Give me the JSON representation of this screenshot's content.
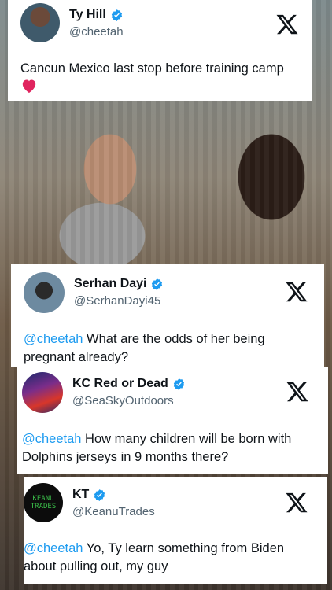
{
  "tweets": [
    {
      "name": "Ty Hill",
      "handle": "@cheetah",
      "text": "Cancun Mexico last stop before training camp",
      "emoji": "red-heart"
    },
    {
      "name": "Serhan Dayi",
      "handle": "@SerhanDayi45",
      "mention": "@cheetah",
      "text": " What are the odds of her being pregnant already?"
    },
    {
      "name": "KC Red or Dead",
      "handle": "@SeaSkyOutdoors",
      "mention": "@cheetah",
      "text": " How many children will be born with Dolphins jerseys in 9 months there?"
    },
    {
      "name": "KT",
      "handle": "@KeanuTrades",
      "mention": "@cheetah",
      "text": " Yo, Ty learn something from Biden about pulling out, my guy",
      "avatar_text_line1": "KEANU",
      "avatar_text_line2": "TRADES"
    }
  ],
  "colors": {
    "verified": "#1d9bf0",
    "mention": "#1d9bf0",
    "heart": "#e0245e",
    "handle": "#536471"
  },
  "icons": {
    "verified": "verified-badge-icon",
    "x_logo": "x-logo-icon",
    "heart": "heart-icon"
  }
}
